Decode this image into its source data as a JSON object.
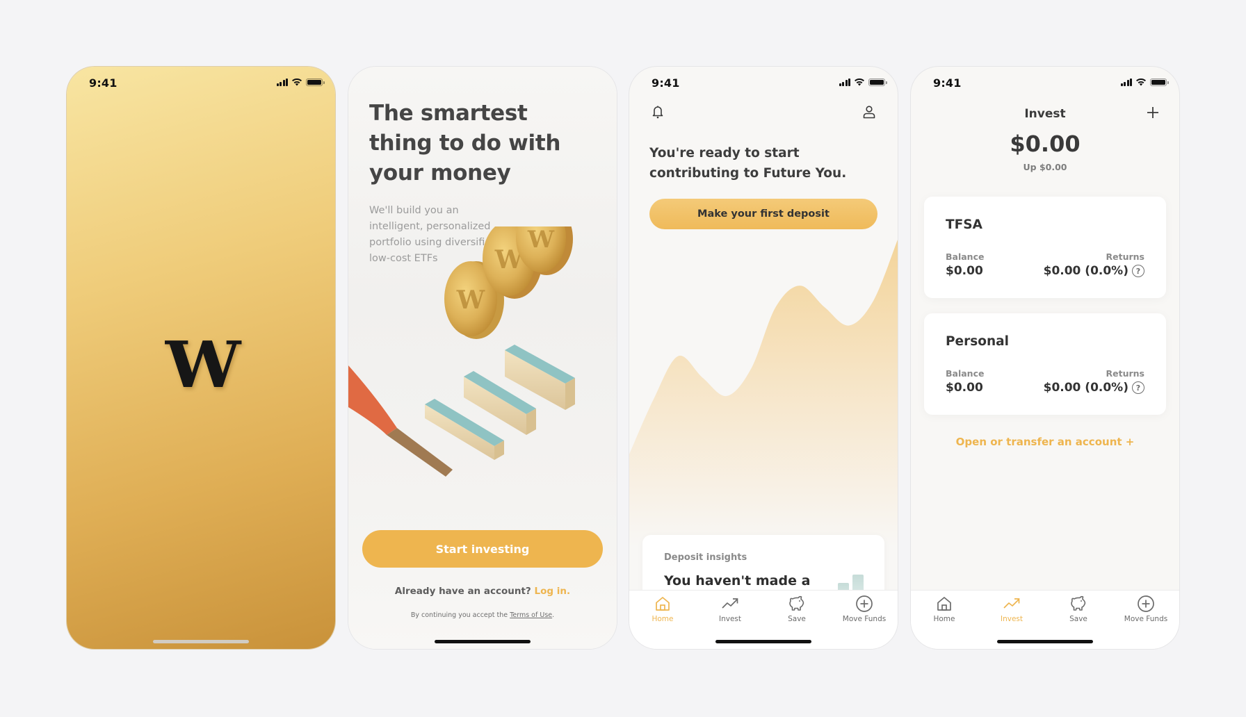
{
  "status_bar": {
    "time": "9:41"
  },
  "splash": {
    "logo_letter": "W"
  },
  "onboarding": {
    "title": "The smartest thing to do with your money",
    "subtitle": "We'll build you an intelligent, personalized portfolio using diversified, low-cost ETFs",
    "primary_button": "Start investing",
    "login_prompt": "Already have an account?",
    "login_link": "Log in.",
    "terms_prefix": "By continuing you accept the",
    "terms_link": "Terms of Use",
    "terms_suffix": "."
  },
  "home": {
    "headline": "You're ready to start contributing to Future You.",
    "deposit_button": "Make your first deposit",
    "insights_label": "Deposit insights",
    "insights_text": "You haven't made a",
    "growth_curve": [
      0.3,
      0.48,
      0.62,
      0.55,
      0.49,
      0.58,
      0.78,
      0.85,
      0.78,
      0.72,
      0.8,
      1.0
    ]
  },
  "invest": {
    "title": "Invest",
    "total": "$0.00",
    "change": "Up $0.00",
    "accounts": [
      {
        "name": "TFSA",
        "balance_label": "Balance",
        "balance": "$0.00",
        "returns_label": "Returns",
        "returns": "$0.00 (0.0%)"
      },
      {
        "name": "Personal",
        "balance_label": "Balance",
        "balance": "$0.00",
        "returns_label": "Returns",
        "returns": "$0.00 (0.0%)"
      }
    ],
    "open_account_link": "Open or transfer an account +"
  },
  "tab_bar": {
    "items": [
      {
        "label": "Home",
        "icon": "home-icon"
      },
      {
        "label": "Invest",
        "icon": "trending-up-icon"
      },
      {
        "label": "Save",
        "icon": "piggy-bank-icon"
      },
      {
        "label": "Move Funds",
        "icon": "plus-circle-icon"
      }
    ],
    "active_on_home_screen": "Home",
    "active_on_invest_screen": "Invest"
  },
  "colors": {
    "accent": "#eeb54f",
    "text_dark": "#3a3a3a",
    "text_muted": "#8a8a8a",
    "page_bg": "#f4f4f6",
    "illustration_teal": "#8fc3c3",
    "illustration_orange": "#e06a43"
  }
}
